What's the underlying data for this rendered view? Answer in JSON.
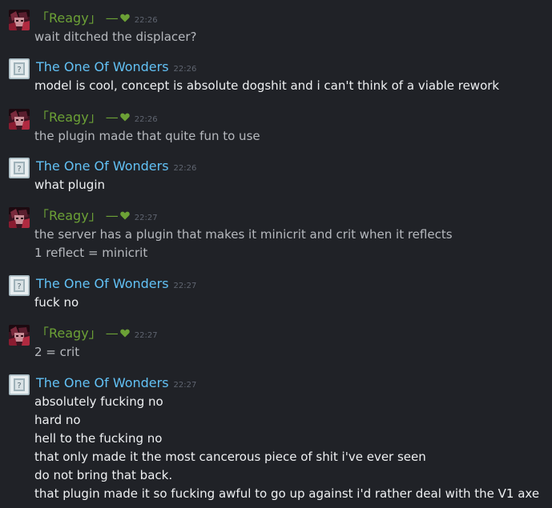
{
  "colors": {
    "background": "#202227",
    "name_reagy": "#6ca136",
    "name_wonders": "#62c1f5",
    "timestamp": "#5f6570",
    "text_reagy": "#b6b9be",
    "text_wonders": "#eef0f2",
    "heart": "#6ca136"
  },
  "messages": [
    {
      "author": "「Reagy」 —",
      "time": "22:26",
      "lines": [
        "wait ditched the displacer?"
      ]
    },
    {
      "author": "The One Of Wonders",
      "time": "22:26",
      "lines": [
        "model is cool, concept is absolute dogshit and i can't think of a viable rework"
      ]
    },
    {
      "author": "「Reagy」 —",
      "time": "22:26",
      "lines": [
        "the plugin made that quite fun to use"
      ]
    },
    {
      "author": "The One Of Wonders",
      "time": "22:26",
      "lines": [
        "what plugin"
      ]
    },
    {
      "author": "「Reagy」 —",
      "time": "22:27",
      "lines": [
        "the server has a plugin that makes it minicrit and crit when it reflects",
        "1 reflect = minicrit"
      ]
    },
    {
      "author": "The One Of Wonders",
      "time": "22:27",
      "lines": [
        "fuck no"
      ]
    },
    {
      "author": "「Reagy」 —",
      "time": "22:27",
      "lines": [
        "2 = crit"
      ]
    },
    {
      "author": "The One Of Wonders",
      "time": "22:27",
      "lines": [
        "absolutely fucking no",
        "hard no",
        "hell to the fucking no",
        "that only made it the most cancerous piece of shit i've ever seen",
        "do not bring that back.",
        "that plugin made it so fucking awful to go up against i'd rather deal with the V1 axe"
      ]
    }
  ]
}
